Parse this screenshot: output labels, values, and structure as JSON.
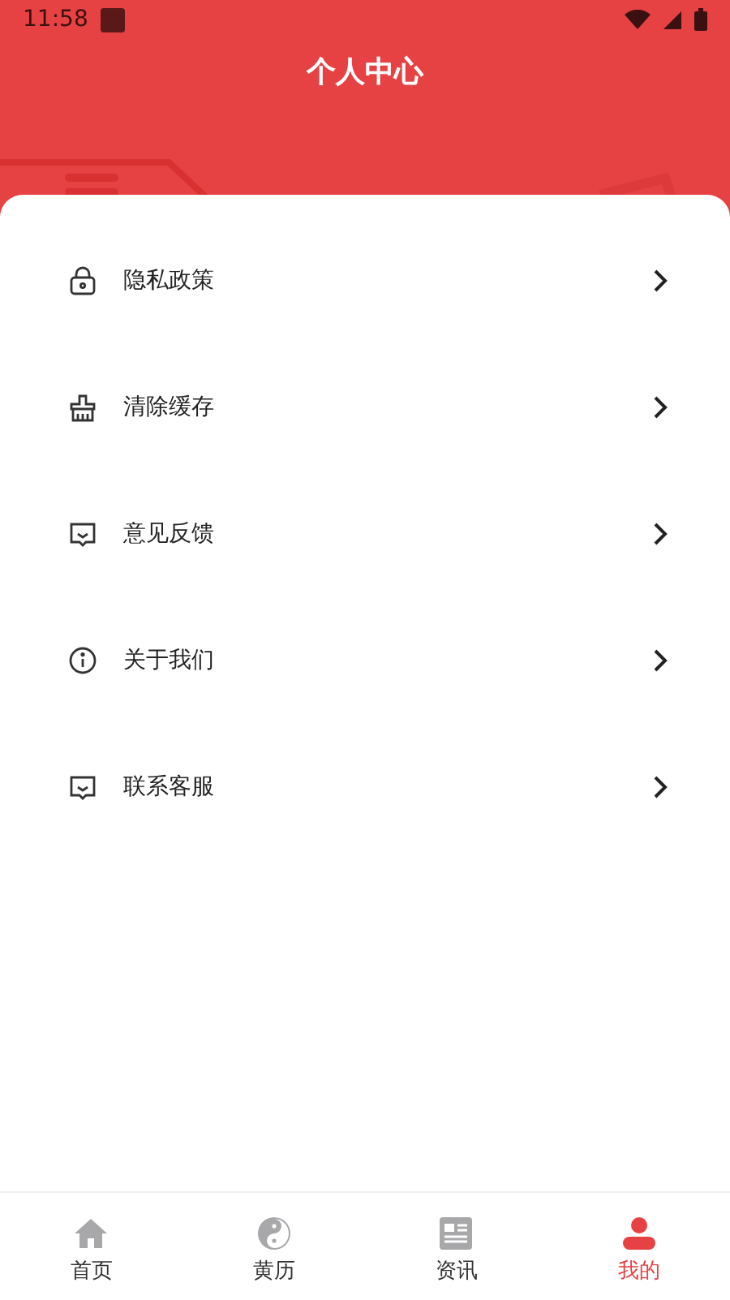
{
  "status_bar": {
    "time": "11:58"
  },
  "header": {
    "title": "个人中心"
  },
  "menu": [
    {
      "kind": "lock",
      "label": "隐私政策"
    },
    {
      "kind": "broom",
      "label": "清除缓存"
    },
    {
      "kind": "message",
      "label": "意见反馈"
    },
    {
      "kind": "info",
      "label": "关于我们"
    },
    {
      "kind": "message",
      "label": "联系客服"
    }
  ],
  "tabs": [
    {
      "kind": "home",
      "label": "首页",
      "selected": false
    },
    {
      "kind": "yinyang",
      "label": "黄历",
      "selected": false
    },
    {
      "kind": "news",
      "label": "资讯",
      "selected": false
    },
    {
      "kind": "user",
      "label": "我的",
      "selected": true
    }
  ]
}
